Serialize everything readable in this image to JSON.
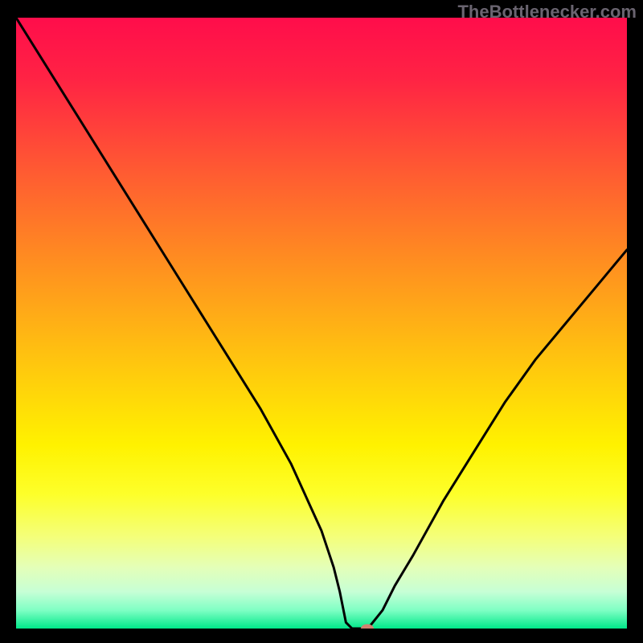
{
  "watermark": "TheBottlenecker.com",
  "chart_data": {
    "type": "line",
    "title": "",
    "xlabel": "",
    "ylabel": "",
    "xlim": [
      0,
      100
    ],
    "ylim": [
      0,
      100
    ],
    "x": [
      0,
      5,
      10,
      15,
      20,
      25,
      30,
      35,
      40,
      45,
      50,
      51,
      52,
      53,
      54,
      55,
      56,
      57,
      58,
      60,
      62,
      65,
      70,
      75,
      80,
      85,
      90,
      95,
      100
    ],
    "values": [
      100,
      92,
      84,
      76,
      68,
      60,
      52,
      44,
      36,
      27,
      16,
      13,
      10,
      6,
      1,
      0,
      0,
      0,
      0.5,
      3,
      7,
      12,
      21,
      29,
      37,
      44,
      50,
      56,
      62
    ],
    "marker": {
      "x": 57.5,
      "y": 0
    },
    "gradient_stops": [
      {
        "pos": 0.0,
        "color": "#ff0d4b"
      },
      {
        "pos": 0.1,
        "color": "#ff2344"
      },
      {
        "pos": 0.25,
        "color": "#ff5a32"
      },
      {
        "pos": 0.4,
        "color": "#ff8e20"
      },
      {
        "pos": 0.55,
        "color": "#ffc110"
      },
      {
        "pos": 0.7,
        "color": "#fff200"
      },
      {
        "pos": 0.78,
        "color": "#fdff2a"
      },
      {
        "pos": 0.85,
        "color": "#f4ff7a"
      },
      {
        "pos": 0.9,
        "color": "#e4ffb8"
      },
      {
        "pos": 0.94,
        "color": "#c6ffd6"
      },
      {
        "pos": 0.97,
        "color": "#7fffc4"
      },
      {
        "pos": 1.0,
        "color": "#00e889"
      }
    ]
  }
}
